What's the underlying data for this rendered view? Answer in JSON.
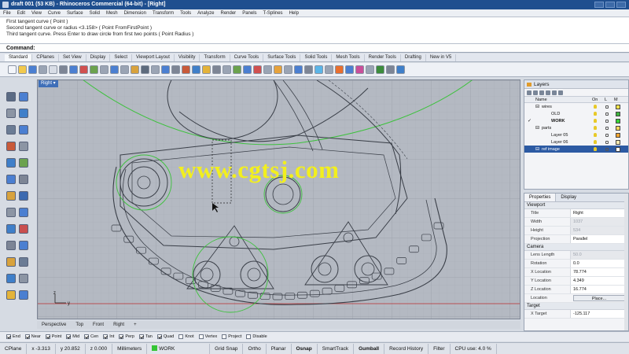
{
  "window": {
    "title": "draft 001 (53 KB) - Rhinoceros Commercial (64-bit) - [Right]"
  },
  "menu": [
    "File",
    "Edit",
    "View",
    "Curve",
    "Surface",
    "Solid",
    "Mesh",
    "Dimension",
    "Transform",
    "Tools",
    "Analyze",
    "Render",
    "Panels",
    "T-Splines",
    "Help"
  ],
  "command": {
    "history": [
      "First tangent curve ( Point )",
      "Second tangent curve or radius <3.158> ( Point FromFirstPoint )",
      "Third tangent curve. Press Enter to draw circle from first two points ( Point Radius )"
    ],
    "prompt": "Command:",
    "value": ""
  },
  "toolbar_tabs": [
    "Standard",
    "CPlanes",
    "Set View",
    "Display",
    "Select",
    "Viewport Layout",
    "Visibility",
    "Transform",
    "Curve Tools",
    "Surface Tools",
    "Solid Tools",
    "Mesh Tools",
    "Render Tools",
    "Drafting",
    "New in V5"
  ],
  "viewport": {
    "title": "Right",
    "axis_z": "z",
    "axis_y": "y",
    "watermark": "www.cgtsj.com"
  },
  "view_tabs": [
    "Perspective",
    "Top",
    "Front",
    "Right",
    "+"
  ],
  "osnaps": [
    {
      "label": "End",
      "checked": true
    },
    {
      "label": "Near",
      "checked": true
    },
    {
      "label": "Point",
      "checked": true
    },
    {
      "label": "Mid",
      "checked": true
    },
    {
      "label": "Cen",
      "checked": true
    },
    {
      "label": "Int",
      "checked": true
    },
    {
      "label": "Perp",
      "checked": true
    },
    {
      "label": "Tan",
      "checked": true
    },
    {
      "label": "Quad",
      "checked": true
    },
    {
      "label": "Knot",
      "checked": false
    },
    {
      "label": "Vertex",
      "checked": false
    },
    {
      "label": "Project",
      "checked": false
    },
    {
      "label": "Disable",
      "checked": false
    }
  ],
  "status": {
    "cplane": "CPlane",
    "x": "x -3.313",
    "y": "y 20.852",
    "z": "z 0.000",
    "units": "Millimeters",
    "layer": "WORK",
    "toggles": [
      "Grid Snap",
      "Ortho",
      "Planar",
      "Osnap",
      "SmartTrack",
      "Gumball",
      "Record History",
      "Filter"
    ],
    "cpu": "CPU use: 4.0 %"
  },
  "layers": {
    "tab": "Layers",
    "columns": [
      "Name",
      "On",
      "L",
      "M"
    ],
    "rows": [
      {
        "name": "wires",
        "indent": 1,
        "color": "#f2e24a",
        "current": false,
        "selected": false
      },
      {
        "name": "OLD",
        "indent": 2,
        "color": "#3cb43c",
        "current": false,
        "selected": false
      },
      {
        "name": "WORK",
        "indent": 2,
        "color": "#35d235",
        "current": true,
        "selected": false
      },
      {
        "name": "parts",
        "indent": 1,
        "color": "#f5d65a",
        "current": false,
        "selected": false
      },
      {
        "name": "Layer 05",
        "indent": 2,
        "color": "#f0a430",
        "current": false,
        "selected": false
      },
      {
        "name": "Layer 06",
        "indent": 2,
        "color": "#f6eab0",
        "current": false,
        "selected": false
      },
      {
        "name": "ref image",
        "indent": 1,
        "color": "#ffffff",
        "current": false,
        "selected": true
      }
    ]
  },
  "properties": {
    "tabs": [
      "Properties",
      "Display"
    ],
    "viewport_section": "Viewport",
    "viewport_rows": [
      {
        "key": "Title",
        "value": "Right",
        "dim": false
      },
      {
        "key": "Width",
        "value": "1037",
        "dim": true
      },
      {
        "key": "Height",
        "value": "534",
        "dim": true
      },
      {
        "key": "Projection",
        "value": "Parallel",
        "dim": false
      }
    ],
    "camera_section": "Camera",
    "camera_rows": [
      {
        "key": "Lens Length",
        "value": "50.0",
        "dim": true
      },
      {
        "key": "Rotation",
        "value": "0.0",
        "dim": false
      },
      {
        "key": "X Location",
        "value": "78.774",
        "dim": false
      },
      {
        "key": "Y Location",
        "value": "4.349",
        "dim": false
      },
      {
        "key": "Z Location",
        "value": "16.774",
        "dim": false
      }
    ],
    "location_label": "Location",
    "place_button": "Place...",
    "target_section": "Target",
    "target_rows": [
      {
        "key": "X Target",
        "value": "-125.117",
        "dim": false
      }
    ]
  }
}
